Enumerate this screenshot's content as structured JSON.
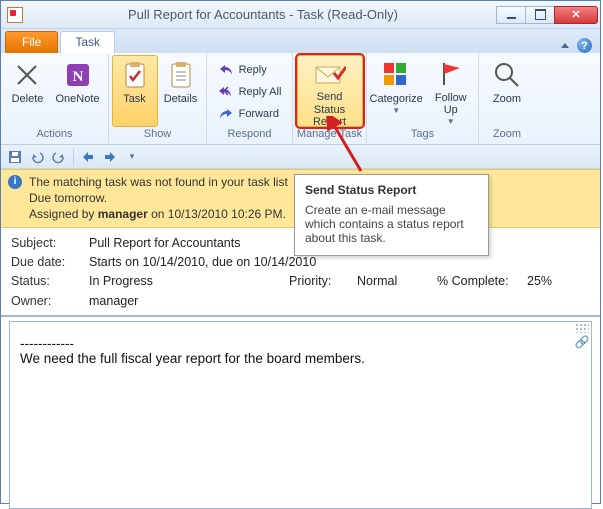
{
  "window": {
    "title": "Pull Report for Accountants  -  Task  (Read-Only)"
  },
  "tabs": {
    "file": "File",
    "task": "Task"
  },
  "ribbon": {
    "actions": {
      "label": "Actions",
      "delete": "Delete",
      "onenote": "OneNote"
    },
    "show": {
      "label": "Show",
      "task": "Task",
      "details": "Details"
    },
    "respond": {
      "label": "Respond",
      "reply": "Reply",
      "reply_all": "Reply All",
      "forward": "Forward"
    },
    "manage": {
      "label": "Manage Task",
      "send_status_report": "Send Status Report"
    },
    "tags": {
      "label": "Tags",
      "categorize": "Categorize",
      "followup": "Follow Up"
    },
    "zoom": {
      "label": "Zoom",
      "zoom": "Zoom"
    }
  },
  "infobar": {
    "line1": "The matching task was not found in your task list",
    "line2": "Due tomorrow.",
    "line3_prefix": "Assigned by ",
    "line3_user": "manager",
    "line3_suffix": " on 10/13/2010 10:26 PM."
  },
  "fields": {
    "subject_label": "Subject:",
    "subject_value": "Pull Report for Accountants",
    "duedate_label": "Due date:",
    "duedate_value": "Starts on 10/14/2010, due on 10/14/2010",
    "status_label": "Status:",
    "status_value": "In Progress",
    "priority_label": "Priority:",
    "priority_value": "Normal",
    "complete_label": "% Complete:",
    "complete_value": "25%",
    "owner_label": "Owner:",
    "owner_value": "manager"
  },
  "body": {
    "dashes": "------------",
    "text": "We need the full fiscal year report for the board members."
  },
  "tooltip": {
    "title": "Send Status Report",
    "text": "Create an e-mail message which contains a status report about this task."
  },
  "colors": {
    "accent_orange": "#ff8c1a",
    "highlight_yellow": "#ffe08a",
    "red_box": "#e02020"
  }
}
